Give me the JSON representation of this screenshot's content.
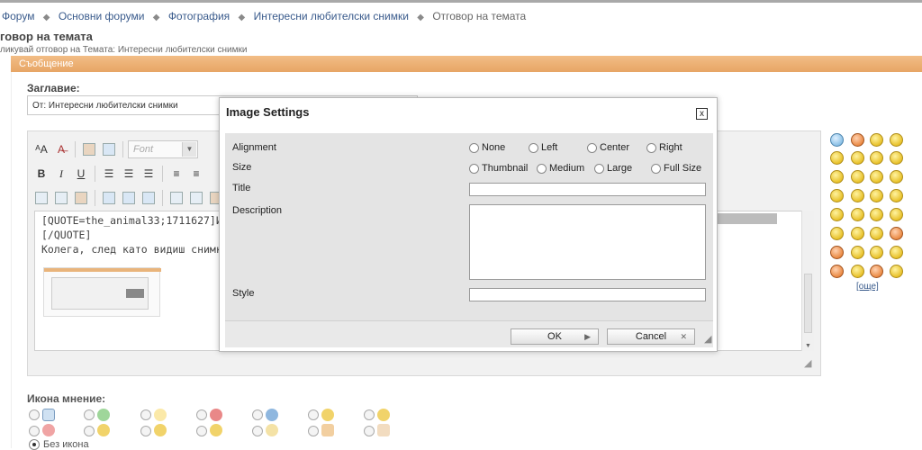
{
  "breadcrumb": {
    "items": [
      "Форум",
      "Основни форуми",
      "Фотография",
      "Интересни любителски снимки"
    ],
    "current": "Отговор на темата"
  },
  "page": {
    "title": "говор на темата",
    "subtitle": "ликувай отговор на Темата: Интересни любителски снимки",
    "section_header": "Съобщение"
  },
  "form": {
    "title_label": "Заглавие:",
    "title_value": "От: Интересни любителски снимки"
  },
  "editor": {
    "font_placeholder": "Font",
    "text_lines": [
      "[QUOTE=the_animal33;1711627]И",
      "[/QUOTE]",
      "Колега, след като видиш снимка"
    ]
  },
  "smilies": {
    "more_label": "[още]"
  },
  "post_icons": {
    "label": "Икона мнение:",
    "no_icon_label": "Без икона"
  },
  "dialog": {
    "title": "Image Settings",
    "close_label": "x",
    "alignment_label": "Alignment",
    "alignment_options": [
      "None",
      "Left",
      "Center",
      "Right"
    ],
    "size_label": "Size",
    "size_options": [
      "Thumbnail",
      "Medium",
      "Large",
      "Full Size"
    ],
    "title_field_label": "Title",
    "description_label": "Description",
    "style_label": "Style",
    "ok_label": "OK",
    "cancel_label": "Cancel"
  }
}
